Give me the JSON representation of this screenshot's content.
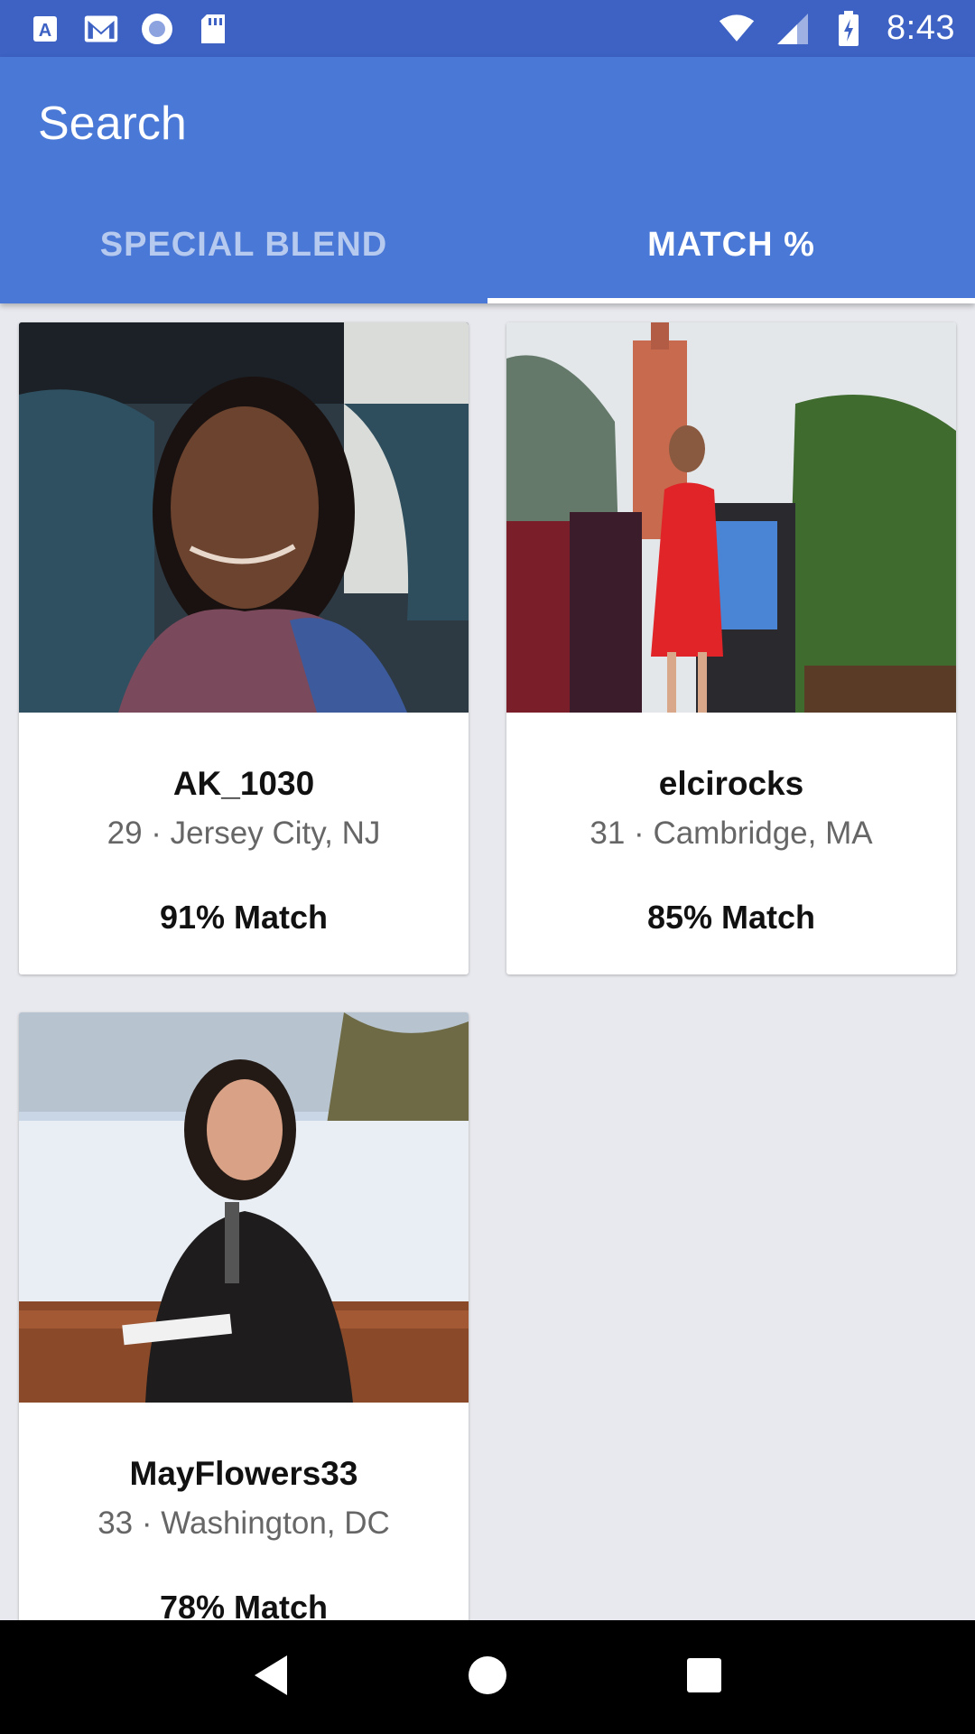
{
  "status_bar": {
    "time": "8:43",
    "left_icons": [
      "a-notification-icon",
      "gmail-icon",
      "circle-app-icon",
      "sd-card-icon"
    ],
    "right_icons": [
      "wifi-icon",
      "signal-icon",
      "battery-charging-icon"
    ]
  },
  "app_bar": {
    "title": "Search",
    "tabs": [
      {
        "label": "SPECIAL BLEND",
        "active": false
      },
      {
        "label": "MATCH %",
        "active": true
      }
    ]
  },
  "profiles": [
    {
      "username": "AK_1030",
      "details": "29 · Jersey City, NJ",
      "match": "91% Match"
    },
    {
      "username": "elcirocks",
      "details": "31 · Cambridge, MA",
      "match": "85% Match"
    },
    {
      "username": "MayFlowers33",
      "details": "33 · Washington, DC",
      "match": "78% Match"
    }
  ],
  "nav_bar": {
    "buttons": [
      "back-icon",
      "home-icon",
      "recents-icon"
    ]
  },
  "colors": {
    "status_bar": "#3d62c4",
    "app_bar": "#4a78d6",
    "background": "#e8e9ee"
  }
}
